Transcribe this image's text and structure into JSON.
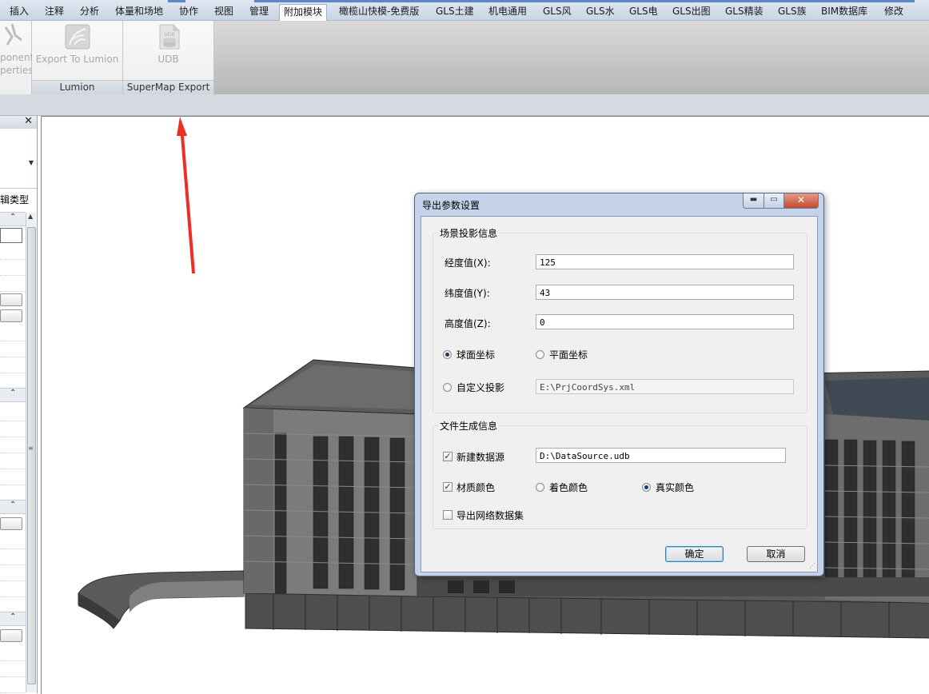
{
  "ribbon": {
    "tabs": [
      "插入",
      "注释",
      "分析",
      "体量和场地",
      "协作",
      "视图",
      "管理",
      "附加模块",
      "橄榄山快模-免费版",
      "GLS土建",
      "机电通用",
      "GLS风",
      "GLS水",
      "GLS电",
      "GLS出图",
      "GLS精装",
      "GLS族",
      "BIM数据库",
      "修改"
    ],
    "active_tab": "附加模块",
    "panels": {
      "partial": {
        "label_1": "ponent",
        "label_2": "perties"
      },
      "lumion": {
        "button": "Export To Lumion",
        "footer": "Lumion"
      },
      "supermap": {
        "button": "UDB",
        "icon_text": "UDB",
        "footer": "SuperMap Export"
      }
    }
  },
  "properties_panel": {
    "close_glyph": "✕",
    "edit_type": "辑类型"
  },
  "colors": {
    "annotation_arrow": "#ee2d24",
    "building_dark": "#4b4b4b",
    "building_mid": "#767676",
    "dialog_frame": "#c4d3ea",
    "dialog_client": "#f0f0f0"
  },
  "dialog": {
    "title": "导出参数设置",
    "scene": {
      "legend": "场景投影信息",
      "lon_label": "经度值(X):",
      "lon_value": "125",
      "lat_label": "纬度值(Y):",
      "lat_value": "43",
      "alt_label": "高度值(Z):",
      "alt_value": "0",
      "spherical_label": "球面坐标",
      "spherical_selected": true,
      "planar_label": "平面坐标",
      "planar_selected": false,
      "custom_label": "自定义投影",
      "custom_selected": false,
      "custom_path": "E:\\PrjCoordSys.xml"
    },
    "file": {
      "legend": "文件生成信息",
      "new_ds_label": "新建数据源",
      "new_ds_checked": true,
      "ds_path": "D:\\DataSource.udb",
      "material_label": "材质颜色",
      "material_checked": true,
      "shading_label": "着色颜色",
      "shading_selected": false,
      "real_label": "真实颜色",
      "real_selected": true,
      "network_label": "导出网络数据集",
      "network_checked": false
    },
    "ok_label": "确定",
    "cancel_label": "取消"
  }
}
